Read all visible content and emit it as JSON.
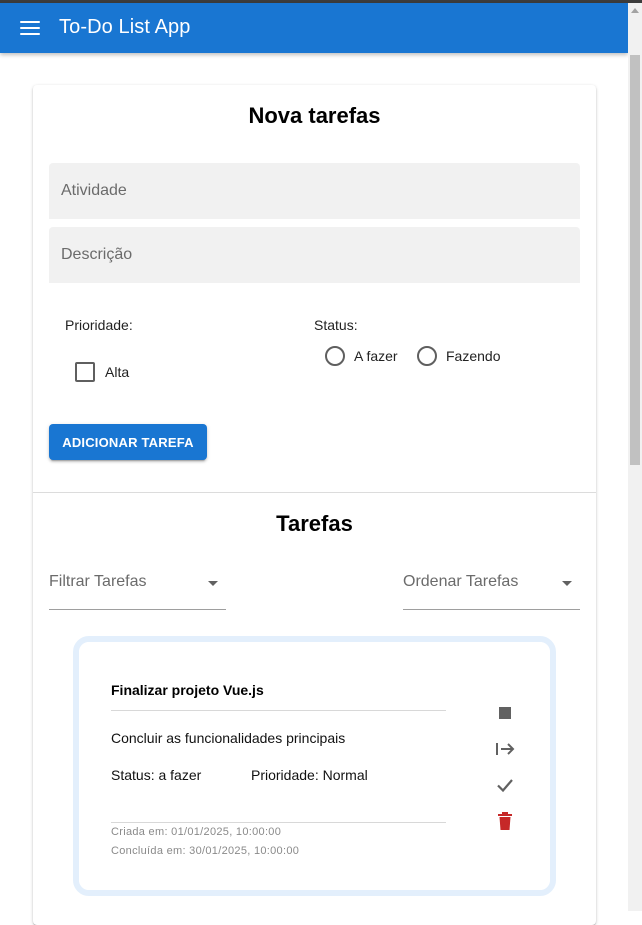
{
  "app": {
    "title": "To-Do List App"
  },
  "form": {
    "title": "Nova tarefas",
    "activity_placeholder": "Atividade",
    "description_placeholder": "Descrição",
    "priority_label": "Prioridade:",
    "priority_option": "Alta",
    "status_label": "Status:",
    "status_options": [
      "A fazer",
      "Fazendo"
    ],
    "submit_label": "ADICIONAR TAREFA"
  },
  "tasks": {
    "title": "Tarefas",
    "filter_label": "Filtrar Tarefas",
    "sort_label": "Ordenar Tarefas",
    "items": [
      {
        "title": "Finalizar projeto Vue.js",
        "description": "Concluir as funcionalidades principais",
        "status": "Status: a fazer",
        "priority": "Prioridade: Normal",
        "created": "Criada em: 01/01/2025, 10:00:00",
        "completed": "Concluída em: 30/01/2025, 10:00:00"
      }
    ]
  },
  "icons": {
    "menu": "menu-icon",
    "stop": "stop-icon",
    "move": "arrow-right-to-bar-icon",
    "done": "check-icon",
    "delete": "trash-icon"
  },
  "colors": {
    "primary": "#1976d2",
    "danger": "#c62828",
    "icon": "#616161"
  }
}
